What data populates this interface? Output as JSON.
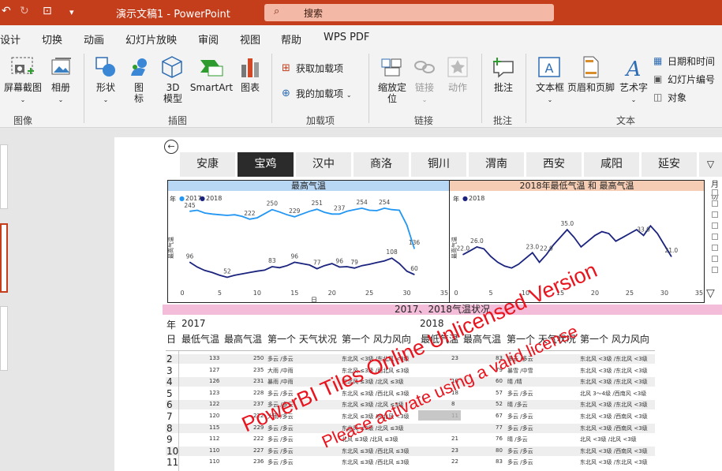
{
  "titlebar": {
    "doc_title": "演示文稿1  -  PowerPoint",
    "search_placeholder": "搜索"
  },
  "tabs": [
    "设计",
    "切换",
    "动画",
    "幻灯片放映",
    "审阅",
    "视图",
    "帮助",
    "WPS PDF"
  ],
  "ribbon": {
    "screenshot": "屏幕截图",
    "album": "相册",
    "images_group": "图像",
    "shapes": "形状",
    "icons": "图\n标",
    "model3d": "3D\n模型",
    "smartart": "SmartArt",
    "chart": "图表",
    "illustrations_group": "插图",
    "get_addins": "获取加载项",
    "my_addins": "我的加载项",
    "addins_group": "加载项",
    "zoom": "缩放定\n位",
    "link": "链接",
    "action": "动作",
    "links_group": "链接",
    "comment": "批注",
    "comments_group": "批注",
    "textbox": "文本框",
    "header_footer": "页眉和页脚",
    "wordart": "艺术字",
    "datetime": "日期和时间",
    "slide_number": "幻灯片编号",
    "object": "对象",
    "text_group": "文本"
  },
  "report": {
    "cities": [
      "安康",
      "宝鸡",
      "汉中",
      "商洛",
      "铜川",
      "渭南",
      "西安",
      "咸阳",
      "延安"
    ],
    "active_city": "宝鸡",
    "side_filter_label": "月份",
    "table_title": "2017、2018气温状况",
    "year_label": "年",
    "year_2017": "2017",
    "year_2018": "2018",
    "day_label": "日",
    "col_min": "最低气温",
    "col_max": "最高气温",
    "col_weather": "第一个 天气状况",
    "col_wind": "第一个 风力风向"
  },
  "chart_data": [
    {
      "type": "line",
      "title": "最高气温",
      "legend_title": "年",
      "xlabel": "日",
      "ylabel": "最高气温",
      "xlim": [
        0,
        35
      ],
      "xticks": [
        0,
        5,
        10,
        15,
        20,
        25,
        30,
        35
      ],
      "series": [
        {
          "name": "2017",
          "color": "#2196f3",
          "x": [
            1,
            2,
            3,
            4,
            5,
            6,
            7,
            8,
            9,
            10,
            11,
            12,
            13,
            14,
            15,
            16,
            17,
            18,
            19,
            20,
            21,
            22,
            23,
            24,
            25,
            26,
            27,
            28,
            29,
            30,
            31
          ],
          "y": [
            245,
            248,
            240,
            237,
            235,
            233,
            235,
            230,
            222,
            226,
            238,
            250,
            243,
            235,
            229,
            237,
            245,
            251,
            242,
            237,
            237,
            245,
            250,
            254,
            248,
            247,
            254,
            250,
            248,
            205,
            136
          ],
          "labels": {
            "1": "245",
            "9": "222",
            "12": "250",
            "15": "229",
            "18": "251",
            "21": "237",
            "24": "254",
            "27": "254",
            "31": "136"
          }
        },
        {
          "name": "2018",
          "color": "#1a237e",
          "x": [
            1,
            2,
            3,
            4,
            5,
            6,
            7,
            8,
            9,
            10,
            11,
            12,
            13,
            14,
            15,
            16,
            17,
            18,
            19,
            20,
            21,
            22,
            23,
            24,
            25,
            26,
            27,
            28,
            29,
            30,
            31
          ],
          "y": [
            96,
            82,
            72,
            66,
            58,
            52,
            58,
            62,
            66,
            70,
            73,
            83,
            80,
            86,
            96,
            92,
            88,
            77,
            86,
            92,
            82,
            83,
            79,
            86,
            90,
            95,
            100,
            108,
            92,
            70,
            60
          ],
          "labels": {
            "1": "96",
            "6": "52",
            "12": "83",
            "15": "96",
            "18": "77",
            "21": "96",
            "23": "79",
            "28": "108",
            "31": "60"
          }
        }
      ]
    },
    {
      "type": "line",
      "title": "2018年最低气温 和 最高气温",
      "legend_title": "年",
      "xlabel": "",
      "ylabel": "最高气温",
      "xlim": [
        0,
        35
      ],
      "xticks": [
        0,
        5,
        10,
        15,
        20,
        25,
        30,
        35
      ],
      "series": [
        {
          "name": "2018",
          "color": "#1a237e",
          "x": [
            1,
            2,
            3,
            4,
            5,
            6,
            7,
            8,
            9,
            10,
            11,
            12,
            13,
            14,
            15,
            16,
            17,
            18,
            19,
            20,
            21,
            22,
            23,
            24,
            25,
            26,
            27,
            28,
            29,
            30,
            31
          ],
          "y": [
            22,
            24,
            26,
            25,
            21,
            18,
            16,
            15,
            17,
            20,
            23,
            18,
            22,
            27,
            31,
            35,
            31,
            26,
            29,
            32,
            34,
            33,
            29,
            31,
            33,
            35,
            32,
            37,
            33,
            27,
            21
          ],
          "labels": {
            "1": "22.0",
            "3": "26.0",
            "11": "23.0",
            "13": "22.0",
            "16": "35.0",
            "27": "33.0",
            "31": "21.0"
          }
        }
      ]
    }
  ],
  "table_rows": [
    {
      "day": "2",
      "min17": "133",
      "max17": "250",
      "w17": "多云 /多云",
      "wind17": "东北风 <3级 /东北风 <3级",
      "min18": "23",
      "max18": "83",
      "w18": "多云 /多云",
      "wind18": "东北风 <3级 /东北风 <3级"
    },
    {
      "day": "3",
      "min17": "127",
      "max17": "235",
      "w17": "大雨 /中雨",
      "wind17": "东北风 ≤3级 /西北风 ≤3级",
      "min18": "",
      "max18": "79",
      "w18": "暴雪 /中雪",
      "wind18": "东北风 <3级 /东北风 <3级"
    },
    {
      "day": "4",
      "min17": "126",
      "max17": "231",
      "w17": "暴雨 /中雨",
      "wind17": "东北风 ≤3级 /北风 ≤3级",
      "min18": "18",
      "max18": "60",
      "w18": "晴 /晴",
      "wind18": "东北风 <3级 /东北风 <3级"
    },
    {
      "day": "5",
      "min17": "123",
      "max17": "228",
      "w17": "多云 /多云",
      "wind17": "东北风 ≤3级 /西北风 ≤3级",
      "min18": "18",
      "max18": "57",
      "w18": "多云 /多云",
      "wind18": "北风 3～4级 /西南风 <3级"
    },
    {
      "day": "6",
      "min17": "122",
      "max17": "237",
      "w17": "多云 /多云",
      "wind17": "东北风 ≤3级 /北风 ≤3级",
      "min18": "8",
      "max18": "52",
      "w18": "晴 /多云",
      "wind18": "东北风 <3级 /东北风 <3级"
    },
    {
      "day": "7",
      "min17": "120",
      "max17": "222",
      "w17": "大雨 /多云",
      "wind17": "东北风 ≤3级 /东北风 <3级",
      "min18": "11",
      "max18": "67",
      "w18": "多云 /多云",
      "wind18": "东北风 <3级 /西南风 <3级"
    },
    {
      "day": "8",
      "min17": "115",
      "max17": "229",
      "w17": "多云 /多云",
      "wind17": "东北风 ≤3级 /北风 ≤3级",
      "min18": "",
      "max18": "77",
      "w18": "多云 /多云",
      "wind18": "东北风 <3级 /西南风 <3级"
    },
    {
      "day": "9",
      "min17": "112",
      "max17": "222",
      "w17": "多云 /多云",
      "wind17": "北风 ≤3级 /北风 ≤3级",
      "min18": "21",
      "max18": "76",
      "w18": "晴 /多云",
      "wind18": "北风 <3级 /北风 <3级"
    },
    {
      "day": "10",
      "min17": "110",
      "max17": "227",
      "w17": "多云 /多云",
      "wind17": "东北风 ≤3级 /西北风 ≤3级",
      "min18": "23",
      "max18": "80",
      "w18": "多云 /多云",
      "wind18": "东北风 <3级 /西南风 <3级"
    },
    {
      "day": "11",
      "min17": "110",
      "max17": "236",
      "w17": "多云 /多云",
      "wind17": "东北风 ≤3级 /西北风 ≤3级",
      "min18": "22",
      "max18": "83",
      "w18": "多云 /多云",
      "wind18": "东北风 <3级 /东北风 <3级"
    }
  ],
  "watermark": {
    "line1": "PowerBI Tiles Online Unlicensed Version",
    "line2": "Please activate using a valid license",
    "color": "#e8141e"
  },
  "colors": {
    "accent": "#c43e1c",
    "chart1_header": "#b7d7f5",
    "chart2_header": "#f5cdb4",
    "table_header": "#f3bcd9"
  }
}
